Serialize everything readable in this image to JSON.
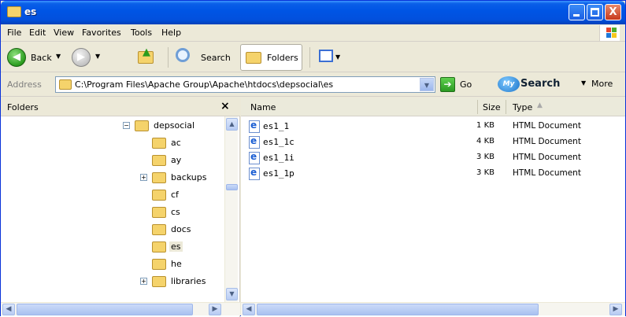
{
  "window": {
    "title": "es",
    "controls": {
      "minimize": "minimize",
      "maximize": "maximize",
      "close": "X"
    }
  },
  "menu": {
    "items": [
      "File",
      "Edit",
      "View",
      "Favorites",
      "Tools",
      "Help"
    ]
  },
  "toolbar": {
    "back_label": "Back",
    "search_label": "Search",
    "folders_label": "Folders"
  },
  "address": {
    "label": "Address",
    "path": "C:\\Program Files\\Apache Group\\Apache\\htdocs\\depsocial\\es",
    "go_label": "Go"
  },
  "mysearch": {
    "logo": "My",
    "label": "Search",
    "more_label": "More"
  },
  "folders_pane": {
    "title": "Folders",
    "close": "×",
    "tree": [
      {
        "label": "depsocial",
        "expander": "−"
      },
      {
        "label": "ac",
        "expander": ""
      },
      {
        "label": "ay",
        "expander": ""
      },
      {
        "label": "backups",
        "expander": "+"
      },
      {
        "label": "cf",
        "expander": ""
      },
      {
        "label": "cs",
        "expander": ""
      },
      {
        "label": "docs",
        "expander": ""
      },
      {
        "label": "es",
        "expander": ""
      },
      {
        "label": "he",
        "expander": ""
      },
      {
        "label": "libraries",
        "expander": "+"
      }
    ]
  },
  "file_list": {
    "columns": {
      "name": "Name",
      "size": "Size",
      "type": "Type"
    },
    "rows": [
      {
        "name": "es1_1",
        "size": "1 KB",
        "type": "HTML Document"
      },
      {
        "name": "es1_1c",
        "size": "4 KB",
        "type": "HTML Document"
      },
      {
        "name": "es1_1i",
        "size": "3 KB",
        "type": "HTML Document"
      },
      {
        "name": "es1_1p",
        "size": "3 KB",
        "type": "HTML Document"
      }
    ]
  },
  "colors": {
    "title_bar": "#0055e5",
    "close_button": "#c7391c",
    "folder": "#f5d36b",
    "selection": "#ece9d8"
  }
}
